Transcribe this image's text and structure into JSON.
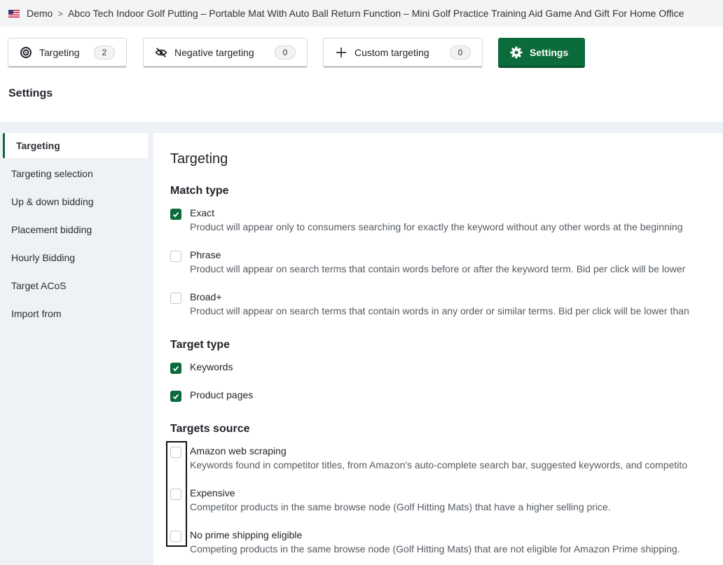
{
  "breadcrumb": {
    "account": "Demo",
    "separator": ">",
    "product": "Abco Tech Indoor Golf Putting – Portable Mat With Auto Ball Return Function – Mini Golf Practice Training Aid Game And Gift For Home Office"
  },
  "tabs": [
    {
      "label": "Targeting",
      "count": "2",
      "icon": "target-icon"
    },
    {
      "label": "Negative targeting",
      "count": "0",
      "icon": "eye-slash-icon"
    },
    {
      "label": "Custom targeting",
      "count": "0",
      "icon": "plus-icon"
    },
    {
      "label": "Settings",
      "icon": "gear-icon",
      "active": true
    }
  ],
  "page_title": "Settings",
  "sidebar": {
    "items": [
      {
        "label": "Targeting",
        "active": true
      },
      {
        "label": "Targeting selection"
      },
      {
        "label": "Up & down bidding"
      },
      {
        "label": "Placement bidding"
      },
      {
        "label": "Hourly Bidding"
      },
      {
        "label": "Target ACoS"
      },
      {
        "label": "Import from"
      }
    ]
  },
  "content": {
    "title": "Targeting",
    "match_type": {
      "title": "Match type",
      "options": [
        {
          "label": "Exact",
          "checked": true,
          "description": "Product will appear only to consumers searching for exactly the keyword without any other words at the beginning"
        },
        {
          "label": "Phrase",
          "checked": false,
          "description": "Product will appear on search terms that contain words before or after the keyword term. Bid per click will be lower"
        },
        {
          "label": "Broad+",
          "checked": false,
          "description": "Product will appear on search terms that contain words in any order or similar terms. Bid per click will be lower than"
        }
      ]
    },
    "target_type": {
      "title": "Target type",
      "options": [
        {
          "label": "Keywords",
          "checked": true
        },
        {
          "label": "Product pages",
          "checked": true
        }
      ]
    },
    "targets_source": {
      "title": "Targets source",
      "options": [
        {
          "label": "Amazon web scraping",
          "checked": false,
          "description": "Keywords found in competitor titles, from Amazon's auto-complete search bar, suggested keywords, and competito"
        },
        {
          "label": "Expensive",
          "checked": false,
          "description": "Competitor products in the same browse node (Golf Hitting Mats) that have a higher selling price."
        },
        {
          "label": "No prime shipping eligible",
          "checked": false,
          "description": "Competing products in the same browse node (Golf Hitting Mats) that are not eligible for Amazon Prime shipping."
        }
      ]
    }
  },
  "colors": {
    "accent": "#0b6b3a",
    "page_bg": "#eef1f5",
    "panel_bg": "#ffffff"
  }
}
